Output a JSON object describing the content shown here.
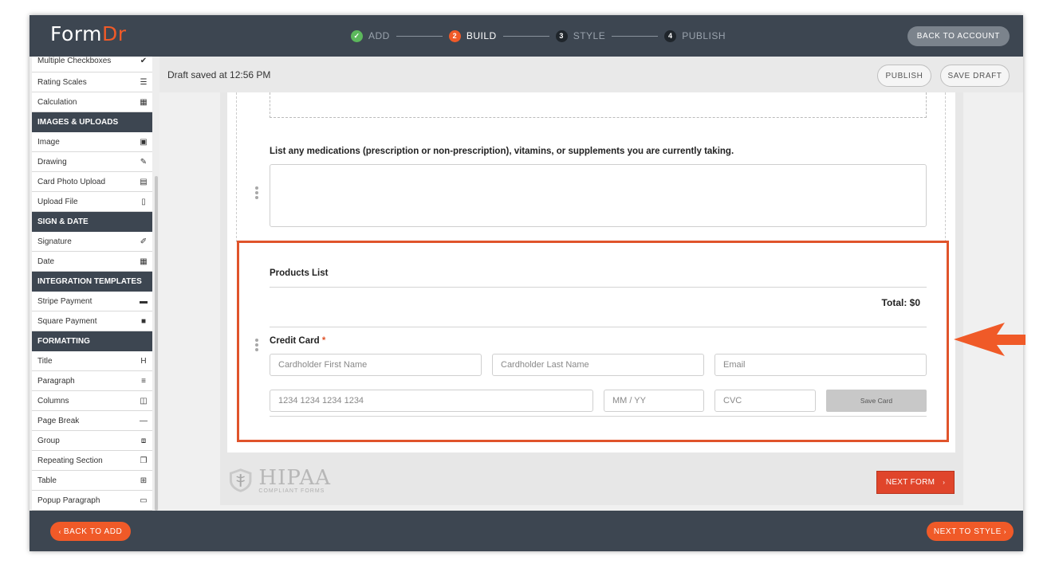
{
  "header": {
    "logo_form": "Form",
    "logo_dr": "Dr",
    "steps": [
      {
        "num": "✓",
        "label": "ADD"
      },
      {
        "num": "2",
        "label": "BUILD"
      },
      {
        "num": "3",
        "label": "STYLE"
      },
      {
        "num": "4",
        "label": "PUBLISH"
      }
    ],
    "back_to_account": "BACK TO ACCOUNT"
  },
  "sidebar": {
    "items": [
      {
        "type": "item",
        "label": "Multiple Checkboxes",
        "icon": "checkmark-icon",
        "glyph": "✔"
      },
      {
        "type": "item",
        "label": "Rating Scales",
        "icon": "list-icon",
        "glyph": "☰"
      },
      {
        "type": "item",
        "label": "Calculation",
        "icon": "calculator-icon",
        "glyph": "▦"
      },
      {
        "type": "head",
        "label": "IMAGES & UPLOADS"
      },
      {
        "type": "item",
        "label": "Image",
        "icon": "image-icon",
        "glyph": "▣"
      },
      {
        "type": "item",
        "label": "Drawing",
        "icon": "edit-icon",
        "glyph": "✎"
      },
      {
        "type": "item",
        "label": "Card Photo Upload",
        "icon": "id-card-icon",
        "glyph": "▤"
      },
      {
        "type": "item",
        "label": "Upload File",
        "icon": "file-icon",
        "glyph": "▯"
      },
      {
        "type": "head",
        "label": "SIGN & DATE"
      },
      {
        "type": "item",
        "label": "Signature",
        "icon": "pencil-icon",
        "glyph": "✐"
      },
      {
        "type": "item",
        "label": "Date",
        "icon": "calendar-icon",
        "glyph": "▦"
      },
      {
        "type": "head",
        "label": "INTEGRATION TEMPLATES"
      },
      {
        "type": "item",
        "label": "Stripe Payment",
        "icon": "credit-card-icon",
        "glyph": "▬"
      },
      {
        "type": "item",
        "label": "Square Payment",
        "icon": "square-icon",
        "glyph": "■"
      },
      {
        "type": "head",
        "label": "FORMATTING"
      },
      {
        "type": "item",
        "label": "Title",
        "icon": "heading-icon",
        "glyph": "H"
      },
      {
        "type": "item",
        "label": "Paragraph",
        "icon": "paragraph-icon",
        "glyph": "≡"
      },
      {
        "type": "item",
        "label": "Columns",
        "icon": "columns-icon",
        "glyph": "◫"
      },
      {
        "type": "item",
        "label": "Page Break",
        "icon": "minus-icon",
        "glyph": "—"
      },
      {
        "type": "item",
        "label": "Group",
        "icon": "group-icon",
        "glyph": "⧈"
      },
      {
        "type": "item",
        "label": "Repeating Section",
        "icon": "copy-icon",
        "glyph": "❐"
      },
      {
        "type": "item",
        "label": "Table",
        "icon": "table-icon",
        "glyph": "⊞"
      },
      {
        "type": "item",
        "label": "Popup Paragraph",
        "icon": "popup-icon",
        "glyph": "▭"
      }
    ]
  },
  "savebar": {
    "draft_status": "Draft saved at 12:56 PM",
    "publish": "PUBLISH",
    "save_draft": "SAVE DRAFT"
  },
  "form": {
    "medications_label": "List any medications (prescription or non-prescription), vitamins, or supplements you are currently taking.",
    "products_title": "Products List",
    "total": "Total: $0",
    "credit_card_label": "Credit Card",
    "required_mark": "*",
    "fields": {
      "first_name": "Cardholder First Name",
      "last_name": "Cardholder Last Name",
      "email": "Email",
      "card_number": "1234 1234 1234 1234",
      "expiry": "MM / YY",
      "cvc": "CVC"
    },
    "save_card": "Save Card",
    "hipaa_big": "HIPAA",
    "hipaa_small": "COMPLIANT FORMS",
    "next_form": "NEXT FORM"
  },
  "footer": {
    "back_to_add": "BACK TO ADD",
    "next_to_style": "NEXT TO STYLE"
  },
  "colors": {
    "brand_orange": "#f05a28",
    "highlight_border": "#e0542b",
    "header_bg": "#3d4651"
  }
}
